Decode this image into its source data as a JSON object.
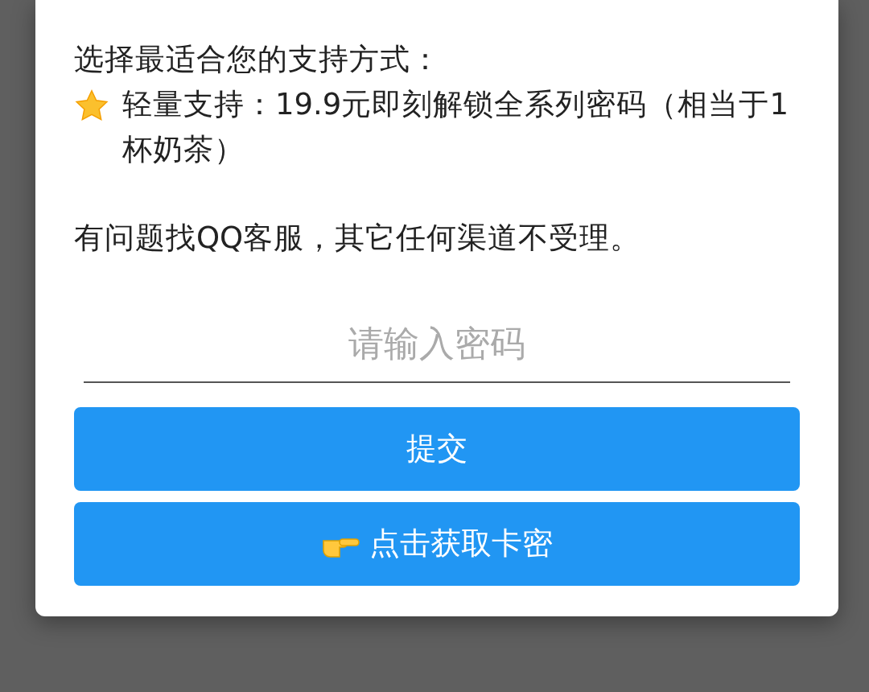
{
  "dialog": {
    "paragraphs": [
      {
        "kind": "plain",
        "text": "选择最适合您的支持方式："
      },
      {
        "kind": "starred",
        "text": "轻量支持：19.9元即刻解锁全系列密码（相当于1杯奶茶）"
      },
      {
        "kind": "gap",
        "text": "有问题找QQ客服，其它任何渠道不受理。"
      }
    ],
    "password": {
      "placeholder": "请输入密码"
    },
    "buttons": [
      {
        "kind": "plain",
        "label": "提交"
      },
      {
        "kind": "pointing",
        "label": "点击获取卡密"
      }
    ]
  }
}
